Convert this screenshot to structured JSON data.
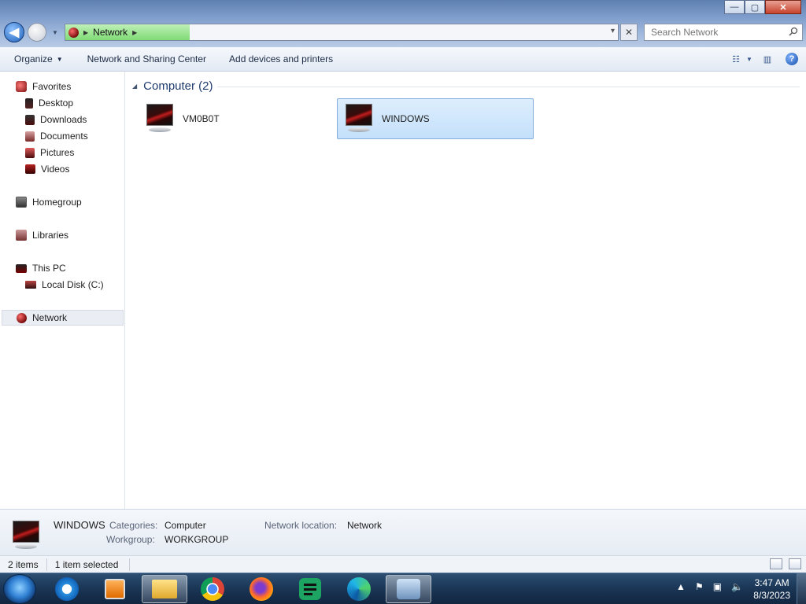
{
  "window": {
    "controls": {
      "minimize": "—",
      "maximize": "▢",
      "close": "✕"
    }
  },
  "address_bar": {
    "path": [
      "Network"
    ],
    "dropdown_icon": "chevron-down-icon",
    "stop_icon": "close-icon"
  },
  "search": {
    "placeholder": "Search Network",
    "value": ""
  },
  "toolbar": {
    "organize": "Organize",
    "network_sharing": "Network and Sharing Center",
    "add_devices": "Add devices and printers"
  },
  "nav": {
    "favorites": "Favorites",
    "desktop": "Desktop",
    "downloads": "Downloads",
    "documents": "Documents",
    "pictures": "Pictures",
    "videos": "Videos",
    "homegroup": "Homegroup",
    "libraries": "Libraries",
    "this_pc": "This PC",
    "local_disk": "Local Disk (C:)",
    "network": "Network"
  },
  "content": {
    "group_title": "Computer (2)",
    "items": [
      {
        "name": "VM0B0T",
        "selected": false
      },
      {
        "name": "WINDOWS",
        "selected": true
      }
    ]
  },
  "details": {
    "name": "WINDOWS",
    "categories_label": "Categories:",
    "categories_value": "Computer",
    "workgroup_label": "Workgroup:",
    "workgroup_value": "WORKGROUP",
    "location_label": "Network location:",
    "location_value": "Network"
  },
  "status": {
    "items_count": "2 items",
    "selected": "1 item selected"
  },
  "taskbar": {
    "apps": [
      "start-orb",
      "internet-explorer",
      "media-player",
      "file-explorer",
      "chrome",
      "firefox",
      "sheets",
      "edge",
      "network-app"
    ],
    "time": "3:47 AM",
    "date": "8/3/2023"
  }
}
